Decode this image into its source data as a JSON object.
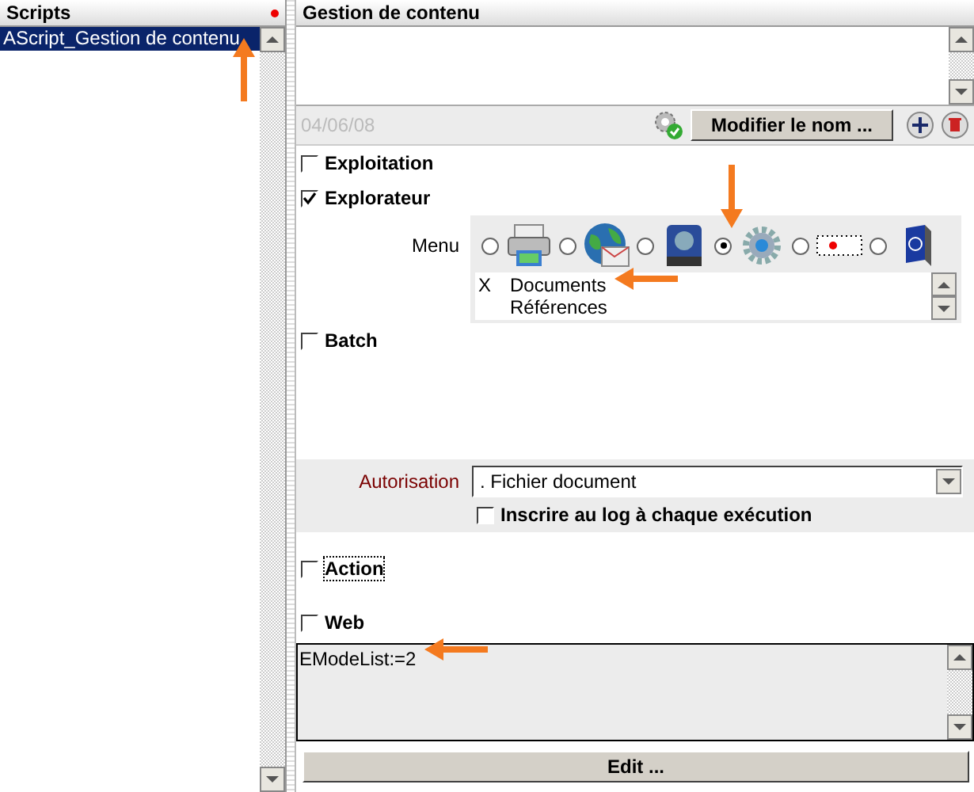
{
  "scripts_panel": {
    "title": "Scripts",
    "modified": true,
    "items": [
      {
        "label": "AScript_Gestion de contenu",
        "selected": true
      }
    ]
  },
  "editor": {
    "title": "Gestion de contenu",
    "date": "04/06/08",
    "rename_button": "Modifier le nom ...",
    "sections": [
      {
        "kind": "plain",
        "label": "Exploitation",
        "checked": false
      },
      {
        "kind": "menu",
        "label": "Explorateur",
        "checked": true,
        "menu_label": "Menu",
        "options": [
          {
            "selected": false
          },
          {
            "selected": false
          },
          {
            "selected": false
          },
          {
            "selected": true
          },
          {
            "selected": false
          },
          {
            "selected": false
          }
        ],
        "entries": [
          {
            "mark": "X",
            "label": "Documents"
          },
          {
            "label": "Références"
          }
        ]
      },
      {
        "kind": "batch",
        "label": "Batch",
        "checked": false,
        "authorization_label": "Autorisation",
        "authorization_value": ". Fichier document",
        "log_checkbox": {
          "label": "Inscrire au log à chaque exécution",
          "checked": false
        }
      },
      {
        "kind": "plain",
        "label": "Action",
        "checked": false,
        "focused": true
      },
      {
        "kind": "plain",
        "label": "Web",
        "checked": false
      }
    ],
    "script": "EModeList:=2",
    "edit_button": "Edit ..."
  }
}
